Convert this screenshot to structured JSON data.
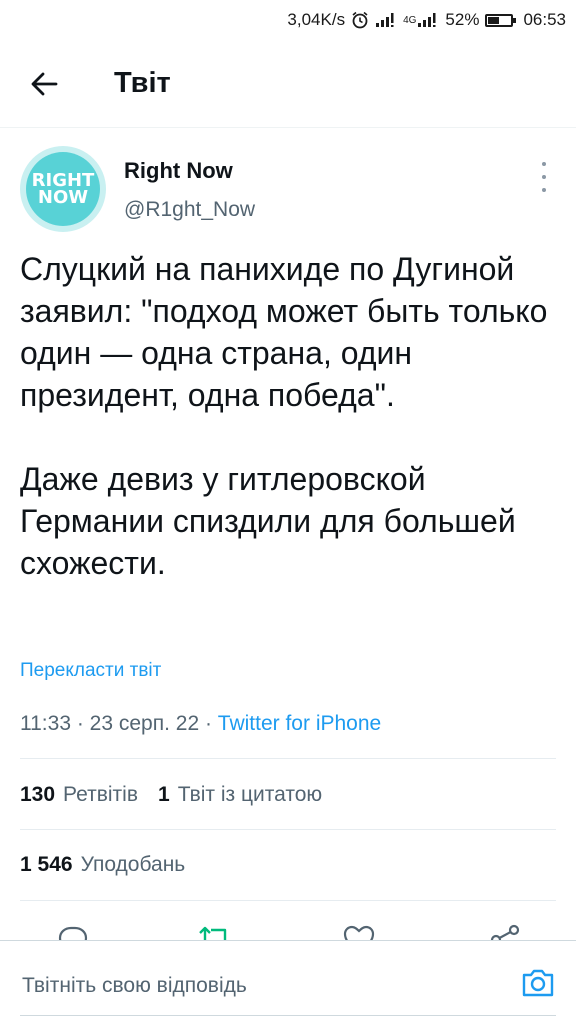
{
  "status_bar": {
    "speed": "3,04K/s",
    "battery_pct": "52%",
    "battery_level": 0.52,
    "time": "06:53",
    "network_label": "4G"
  },
  "header": {
    "title": "Твіт"
  },
  "author": {
    "avatar_line1": "RIGHT",
    "avatar_line2": "NOW",
    "display_name": "Right Now",
    "handle": "@R1ght_Now"
  },
  "tweet": {
    "text": "Слуцкий на панихиде по Дугиной заявил: \"подход может быть только один — одна страна, один президент, одна победа\".\n\nДаже девиз у гитлеровской Германии спиздили для большей схожести.",
    "translate_label": "Перекласти твіт",
    "time": "11:33",
    "date": "23 серп. 22",
    "source": "Twitter for iPhone"
  },
  "stats": {
    "retweets_count": "130",
    "retweets_label": "Ретвітів",
    "quotes_count": "1",
    "quotes_label": "Твіт із цитатою",
    "likes_count": "1 546",
    "likes_label": "Уподобань"
  },
  "colors": {
    "accent": "#1d9bf0",
    "retweet_green": "#00ba7c",
    "avatar_bg": "#58d2d6"
  },
  "icons": {
    "back": "arrow-left-icon",
    "more": "more-vertical-icon",
    "reply": "reply-icon",
    "retweet": "retweet-icon",
    "like": "heart-icon",
    "share": "share-icon",
    "camera": "camera-icon"
  },
  "reply_bar": {
    "placeholder": "Твітніть свою відповідь"
  }
}
